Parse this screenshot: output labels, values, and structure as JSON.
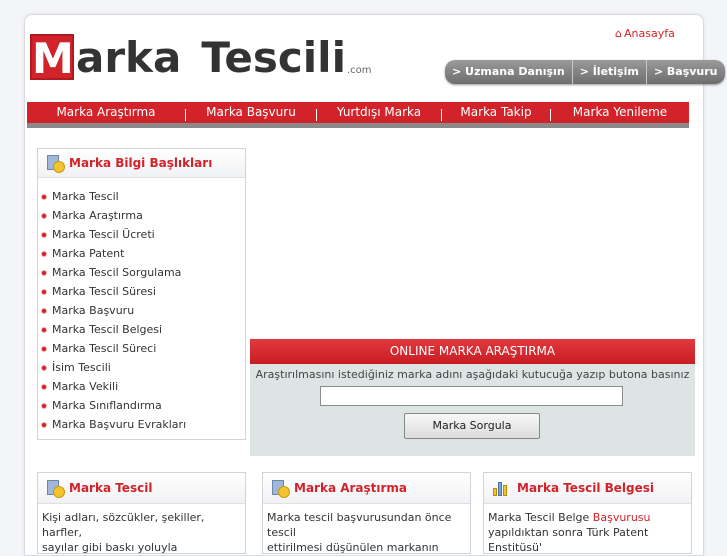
{
  "brand": {
    "m": "M",
    "arka": "arka",
    "tescili": "Tescili",
    "com": ".com"
  },
  "header": {
    "home_link": "Anasayfa",
    "buttons": [
      "> Uzmana Danışın",
      "> İletişim",
      "> Başvuru"
    ]
  },
  "nav": {
    "items": [
      "Marka Araştırma",
      "Marka Başvuru",
      "Yurtdışı Marka",
      "Marka Takip",
      "Marka Yenileme"
    ]
  },
  "sidebar": {
    "title": "Marka Bilgi Başlıkları",
    "items": [
      "Marka Tescil",
      "Marka Araştırma",
      "Marka Tescil Ücreti",
      "Marka Patent",
      "Marka Tescil Sorgulama",
      "Marka Tescil Süresi",
      "Marka Başvuru",
      "Marka Tescil Belgesi",
      "Marka Tescil Süreci",
      "İsim Tescili",
      "Marka Vekili",
      "Marka Sınıflandırma",
      "Marka Başvuru Evrakları"
    ]
  },
  "search": {
    "title": "ONLINE MARKA ARAŞTIRMA",
    "description": "Araştırılmasını istediğiniz marka adını aşağıdaki kutucuğa yazıp butona basınız",
    "input_value": "",
    "button_label": "Marka Sorgula"
  },
  "boxes": [
    {
      "title": "Marka Tescil",
      "text_1": "Kişi adları, sözcükler, şekiller, harfler,",
      "text_2": "sayılar gibi baskı yoluyla yayınlanabilen"
    },
    {
      "title": "Marka Araştırma",
      "text_1": "Marka tescil başvurusundan önce tescil",
      "text_2": "ettirilmesi düşünülen markanın"
    },
    {
      "title": "Marka Tescil Belgesi",
      "text_1a": "Marka Tescil Belge ",
      "text_1b": "Başvurusu",
      "text_2": "yapıldıktan sonra Türk Patent Enstitüsü'"
    }
  ],
  "colors": {
    "accent": "#d2232a",
    "nav_bg": "#d2232a",
    "search_bg": "#dce5e3"
  }
}
